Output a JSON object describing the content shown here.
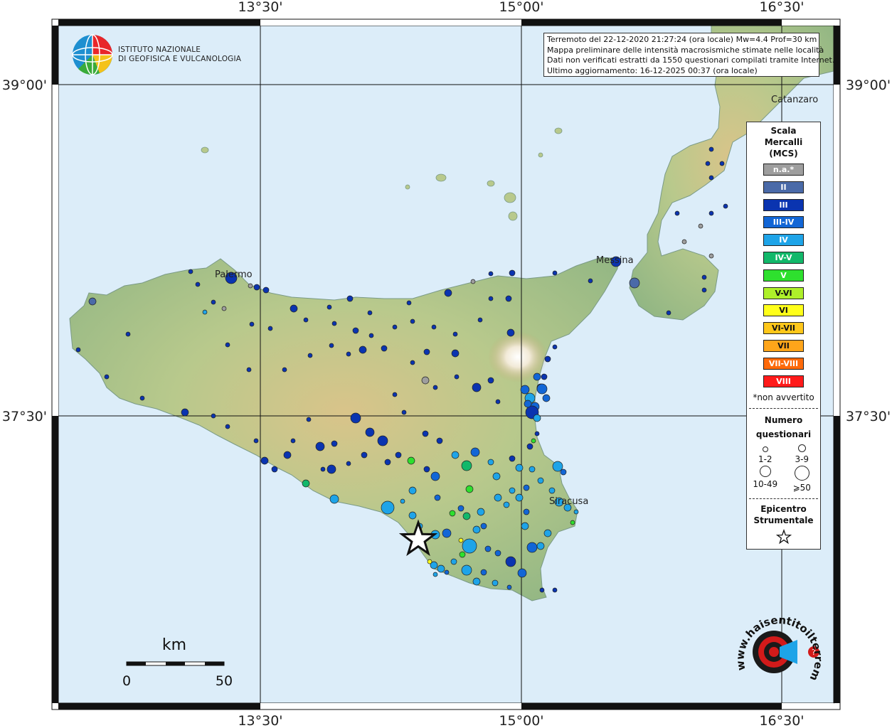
{
  "info": {
    "line1": "Terremoto del 22-12-2020 21:27:24 (ora locale) Mw=4.4 Prof=30 km",
    "line2": "Mappa preliminare delle intensità macrosismiche stimate nelle località",
    "line3": "Dati non verificati estratti da 1550 questionari compilati tramite Internet.",
    "line4": "Ultimo aggiornamento: 16-12-2025 00:37 (ora locale)"
  },
  "institute": {
    "line1": "ISTITUTO NAZIONALE",
    "line2": "DI GEOFISICA E VULCANOLOGIA"
  },
  "axes": {
    "lon_labels": [
      "13°30'",
      "15°00'",
      "16°30'"
    ],
    "lat_labels": [
      "39°00'",
      "37°30'"
    ]
  },
  "cities": [
    "Palermo",
    "Messina",
    "Catanzaro",
    "Siracusa"
  ],
  "legend": {
    "scale_title_1": "Scala",
    "scale_title_2": "Mercalli",
    "scale_title_3": "(MCS)",
    "levels": [
      {
        "label": "n.a.*",
        "color": "#9e9e9e"
      },
      {
        "label": "II",
        "color": "#4a6aa8"
      },
      {
        "label": "III",
        "color": "#0a34b0"
      },
      {
        "label": "III-IV",
        "color": "#1266d6"
      },
      {
        "label": "IV",
        "color": "#1ea4e8"
      },
      {
        "label": "IV-V",
        "color": "#12b86a"
      },
      {
        "label": "V",
        "color": "#2ee02e"
      },
      {
        "label": "V-VI",
        "color": "#aef02a"
      },
      {
        "label": "VI",
        "color": "#ffff1a"
      },
      {
        "label": "VI-VII",
        "color": "#ffc71a"
      },
      {
        "label": "VII",
        "color": "#ffa51a"
      },
      {
        "label": "VII-VIII",
        "color": "#ff6a0a"
      },
      {
        "label": "VIII",
        "color": "#ff1a1a"
      }
    ],
    "not_felt_note": "*non avvertito",
    "count_title_1": "Numero",
    "count_title_2": "questionari",
    "count_labels": [
      "1-2",
      "3-9",
      "10-49",
      "⩾50"
    ],
    "epicenter_title_1": "Epicentro",
    "epicenter_title_2": "Strumentale"
  },
  "scale_bar": {
    "unit": "km",
    "min": "0",
    "max": "50"
  },
  "hst_logo": {
    "text": "www.haisentitoilterremoto.it"
  }
}
